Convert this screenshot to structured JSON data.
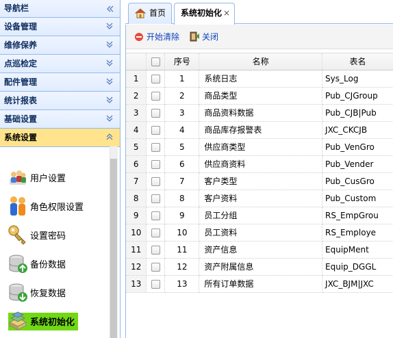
{
  "sidebar": {
    "title": "导航栏",
    "sections": [
      {
        "label": "设备管理"
      },
      {
        "label": "维修保养"
      },
      {
        "label": "点巡检定"
      },
      {
        "label": "配件管理"
      },
      {
        "label": "统计报表"
      },
      {
        "label": "基础设置"
      },
      {
        "label": "系统设置"
      }
    ],
    "items": [
      {
        "label": "用户设置",
        "icon": "users-icon"
      },
      {
        "label": "角色权限设置",
        "icon": "role-permission-icon"
      },
      {
        "label": "设置密码",
        "icon": "key-icon"
      },
      {
        "label": "备份数据",
        "icon": "backup-database-icon"
      },
      {
        "label": "恢复数据",
        "icon": "restore-database-icon"
      },
      {
        "label": "系统初始化",
        "icon": "system-init-icon"
      }
    ]
  },
  "tabs": [
    {
      "label": "首页",
      "icon": "home-icon"
    },
    {
      "label": "系统初始化",
      "close": "×"
    }
  ],
  "toolbar": {
    "clear_label": "开始清除",
    "close_label": "关闭"
  },
  "grid": {
    "columns": [
      "序号",
      "名称",
      "表名"
    ],
    "rows": [
      {
        "rn": "1",
        "seq": "1",
        "name": "系统日志",
        "table": "Sys_Log"
      },
      {
        "rn": "2",
        "seq": "2",
        "name": "商品类型",
        "table": "Pub_CJGroup"
      },
      {
        "rn": "3",
        "seq": "3",
        "name": "商品资料数据",
        "table": "Pub_CJB|Pub"
      },
      {
        "rn": "4",
        "seq": "4",
        "name": "商品库存报警表",
        "table": "JXC_CKCJB"
      },
      {
        "rn": "5",
        "seq": "5",
        "name": "供应商类型",
        "table": "Pub_VenGro"
      },
      {
        "rn": "6",
        "seq": "6",
        "name": "供应商资料",
        "table": "Pub_Vender"
      },
      {
        "rn": "7",
        "seq": "7",
        "name": "客户类型",
        "table": "Pub_CusGro"
      },
      {
        "rn": "8",
        "seq": "8",
        "name": "客户资料",
        "table": "Pub_Custom"
      },
      {
        "rn": "9",
        "seq": "9",
        "name": "员工分组",
        "table": "RS_EmpGrou"
      },
      {
        "rn": "10",
        "seq": "10",
        "name": "员工资料",
        "table": "RS_Employe"
      },
      {
        "rn": "11",
        "seq": "11",
        "name": "资产信息",
        "table": "EquipMent"
      },
      {
        "rn": "12",
        "seq": "12",
        "name": "资产附属信息",
        "table": "Equip_DGGL"
      },
      {
        "rn": "13",
        "seq": "13",
        "name": "所有订单数据",
        "table": "JXC_BJM|JXC"
      }
    ]
  },
  "colors": {
    "header_gradient_top": "#eff5ff",
    "header_gradient_bottom": "#e0ecff",
    "border": "#95b8e7",
    "open_section": "#ffe48d",
    "active_item": "#72d816",
    "link": "#0c3fbf"
  }
}
